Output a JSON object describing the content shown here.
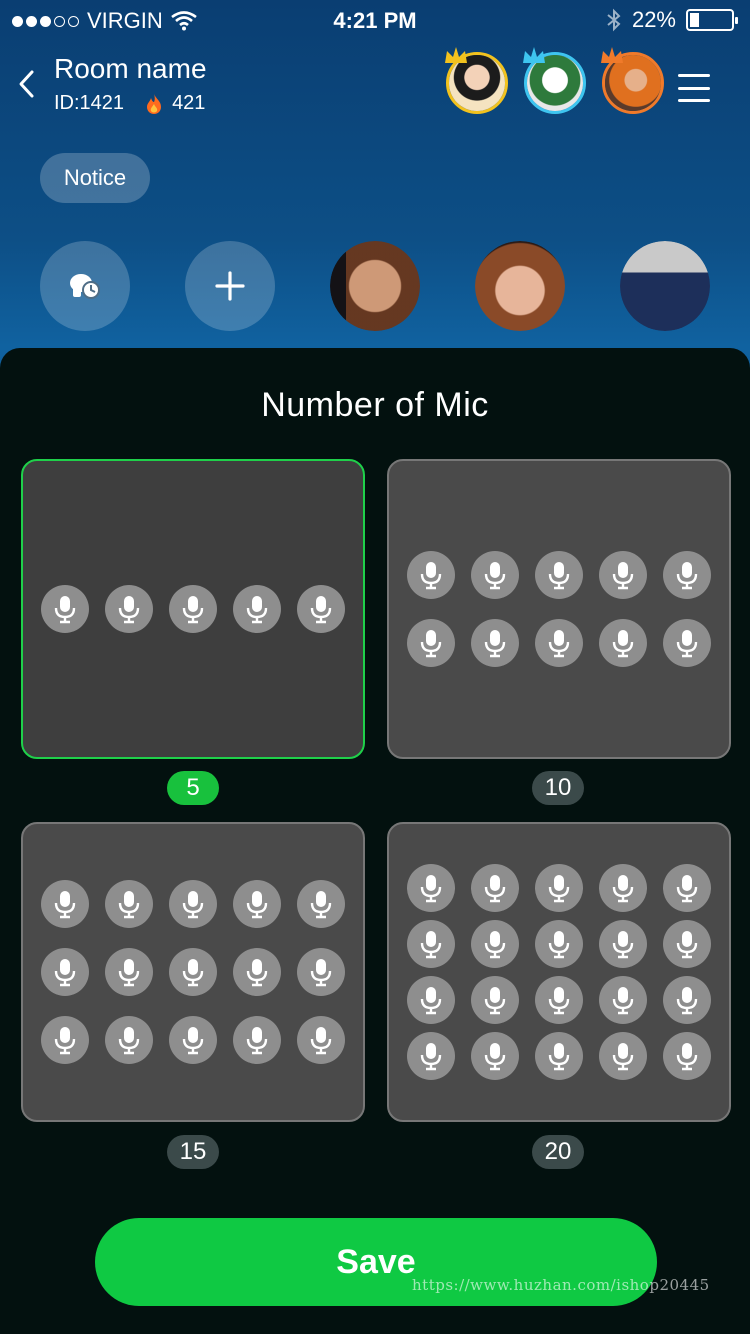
{
  "status_bar": {
    "carrier": "VIRGIN",
    "time": "4:21 PM",
    "battery_percent": "22%",
    "battery_level": 0.22
  },
  "header": {
    "room_name": "Room name",
    "room_id": "ID:1421",
    "popularity": "421",
    "top_avatars": [
      {
        "name": "top-avatar-1",
        "ring_color": "#f2c21e",
        "crown_color": "#f2c21e"
      },
      {
        "name": "top-avatar-2",
        "ring_color": "#3ec5f0",
        "crown_color": "#3ec5f0"
      },
      {
        "name": "top-avatar-3",
        "ring_color": "#f07a2a",
        "crown_color": "#f07a2a"
      }
    ]
  },
  "notice": {
    "label": "Notice"
  },
  "seats": [
    {
      "type": "icon",
      "icon": "host-clock-icon"
    },
    {
      "type": "icon",
      "icon": "plus-icon"
    },
    {
      "type": "photo"
    },
    {
      "type": "photo"
    },
    {
      "type": "photo"
    }
  ],
  "sheet": {
    "title": "Number of Mic",
    "options": [
      {
        "count": "5",
        "rows": 1,
        "selected": true
      },
      {
        "count": "10",
        "rows": 2,
        "selected": false
      },
      {
        "count": "15",
        "rows": 3,
        "selected": false
      },
      {
        "count": "20",
        "rows": 4,
        "selected": false
      }
    ],
    "save_label": "Save"
  },
  "watermark": "https://www.huzhan.com/ishop20445",
  "colors": {
    "accent_green": "#0fc943",
    "selected_border": "#1fd04a",
    "card_bg": "#4a4a4a"
  }
}
